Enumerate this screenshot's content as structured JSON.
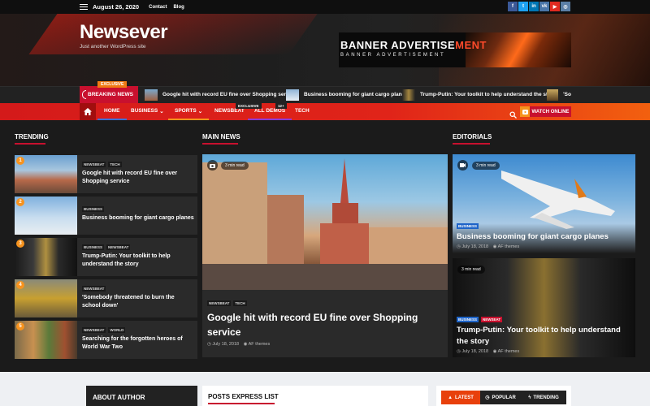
{
  "topbar": {
    "date": "August 26, 2020",
    "links": [
      "Contact",
      "Blog"
    ]
  },
  "socials": [
    {
      "icon": "facebook-icon",
      "glyph": "f",
      "color": "#3b5998"
    },
    {
      "icon": "twitter-icon",
      "glyph": "t",
      "color": "#1da1f2"
    },
    {
      "icon": "linkedin-icon",
      "glyph": "in",
      "color": "#0077b5"
    },
    {
      "icon": "vk-icon",
      "glyph": "vk",
      "color": "#4a76a8"
    },
    {
      "icon": "youtube-icon",
      "glyph": "▶",
      "color": "#e02a20"
    },
    {
      "icon": "instagram-icon",
      "glyph": "◎",
      "color": "#5b7fa6"
    }
  ],
  "site": {
    "title": "Newsever",
    "tagline": "Just another WordPress site"
  },
  "banner": {
    "line1_a": "BANNER ADVERTISE",
    "line1_b": "MENT",
    "line2": "BANNER ADVERTISEMENT"
  },
  "breaking": {
    "label": "BREAKING NEWS",
    "exclusive": "EXCLUSIVE",
    "items": [
      "Google hit with record EU fine over Shopping service",
      "Business booming for giant cargo planes",
      "Trump-Putin: Your toolkit to help understand the story",
      "'So"
    ]
  },
  "nav": {
    "items": [
      "HOME",
      "BUSINESS",
      "SPORTS",
      "NEWSBEAT",
      "ALL DEMOS",
      "TECH"
    ],
    "badge_exclusive": "EXCLUSIVE",
    "badge_count": "12+",
    "watch": "WATCH ONLINE"
  },
  "sections": {
    "trending": "TRENDING",
    "main": "MAIN NEWS",
    "editorials": "EDITORIALS"
  },
  "trending": [
    {
      "num": "1",
      "tags": [
        "NEWSBEAT",
        "TECH"
      ],
      "title": "Google hit with record EU fine over Shopping service"
    },
    {
      "num": "2",
      "tags": [
        "BUSINESS"
      ],
      "title": "Business booming for giant cargo planes"
    },
    {
      "num": "3",
      "tags": [
        "BUSINESS",
        "NEWSBEAT"
      ],
      "title": "Trump-Putin: Your toolkit to help understand the story"
    },
    {
      "num": "4",
      "tags": [
        "NEWSBEAT"
      ],
      "title": "'Somebody threatened to burn the school down'"
    },
    {
      "num": "5",
      "tags": [
        "NEWSBEAT",
        "WORLD"
      ],
      "title": "Searching for the forgotten heroes of World War Two"
    }
  ],
  "main_news": {
    "read": "3 min read",
    "tags": [
      "NEWSBEAT",
      "TECH"
    ],
    "title": "Google hit with record EU fine over Shopping service",
    "date": "July 18, 2018",
    "author": "AF themes"
  },
  "editorials": [
    {
      "read": "3 min read",
      "tags": [
        "BUSINESS"
      ],
      "title": "Business booming for giant cargo planes",
      "date": "July 18, 2018",
      "author": "AF themes"
    },
    {
      "read": "3 min read",
      "tags": [
        "BUSINESS",
        "NEWSEAT"
      ],
      "title": "Trump-Putin: Your toolkit to help understand the story",
      "date": "July 18, 2018",
      "author": "AF themes"
    }
  ],
  "bottom": {
    "about": "ABOUT AUTHOR",
    "express": "POSTS EXPRESS LIST",
    "tabs": [
      "LATEST",
      "POPULAR",
      "TRENDING"
    ]
  }
}
